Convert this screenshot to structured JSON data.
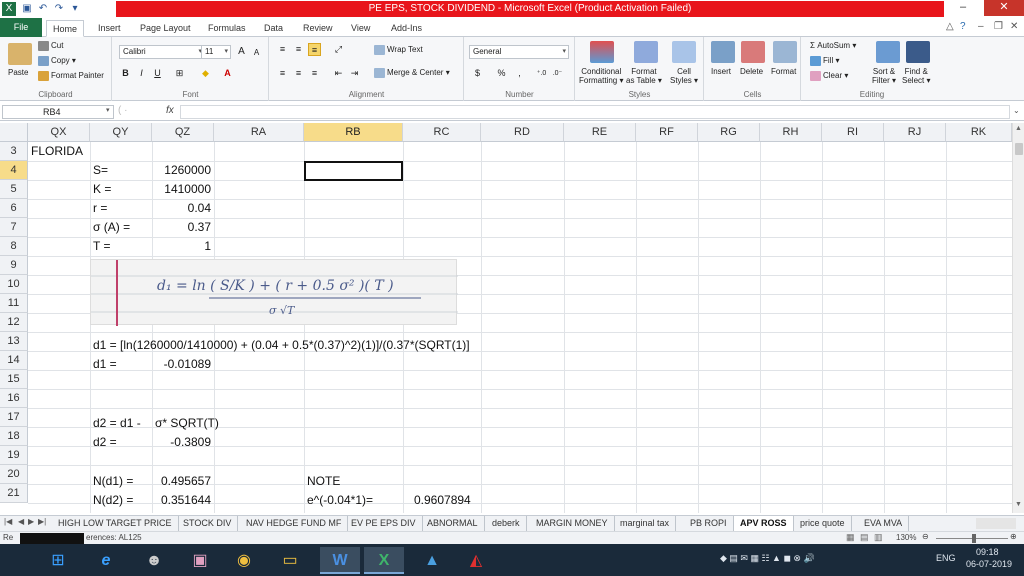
{
  "window": {
    "title": "PE EPS, STOCK DIVIDEND - Microsoft Excel (Product Activation Failed)",
    "accent": "#e8151b"
  },
  "ribbon_tabs": [
    "File",
    "Home",
    "Insert",
    "Page Layout",
    "Formulas",
    "Data",
    "Review",
    "View",
    "Add-Ins"
  ],
  "ribbon": {
    "clipboard": {
      "paste": "Paste",
      "cut": "Cut",
      "copy": "Copy",
      "format_painter": "Format Painter",
      "label": "Clipboard"
    },
    "font": {
      "name": "Calibri",
      "size": "11",
      "bold": "B",
      "italic": "I",
      "underline": "U",
      "label": "Font",
      "grow": "A",
      "shrink": "A"
    },
    "alignment": {
      "wrap": "Wrap Text",
      "merge": "Merge & Center",
      "label": "Alignment"
    },
    "number": {
      "format": "General",
      "currency": "$",
      "percent": "%",
      "comma": ",",
      "label": "Number"
    },
    "styles": {
      "conditional": "Conditional",
      "conditional2": "Formatting",
      "format_table": "Format",
      "format_table2": "as Table",
      "cell_styles": "Cell",
      "cell_styles2": "Styles",
      "label": "Styles"
    },
    "cells": {
      "insert": "Insert",
      "delete": "Delete",
      "format": "Format",
      "label": "Cells"
    },
    "editing": {
      "autosum": "AutoSum",
      "fill": "Fill",
      "clear": "Clear",
      "sort": "Sort &",
      "sort2": "Filter",
      "find": "Find &",
      "find2": "Select",
      "label": "Editing"
    }
  },
  "formula_bar": {
    "name_box": "RB4",
    "fx": "fx",
    "formula": ""
  },
  "columns": [
    "QX",
    "QY",
    "QZ",
    "RA",
    "RB",
    "RC",
    "RD",
    "RE",
    "RF",
    "RG",
    "RH",
    "RI",
    "RJ",
    "RK"
  ],
  "rows": [
    "3",
    "4",
    "5",
    "6",
    "7",
    "8",
    "9",
    "10",
    "11",
    "12",
    "13",
    "14",
    "15",
    "16",
    "17",
    "18",
    "19",
    "20",
    "21"
  ],
  "cells": {
    "qx3": "FLORIDA",
    "qy4": "S=",
    "qz4": "1260000",
    "qy5": "K =",
    "qz5": "1410000",
    "qy6": "r =",
    "qz6": "0.04",
    "qy7": "σ (A) =",
    "qz7": "0.37",
    "qy8": "T =",
    "qz8": "1",
    "qy13": "d1 = [ln(1260000/1410000) + (0.04 + 0.5*(0.37)^2)(1)]/(0.37*(SQRT(1)]",
    "qy14": "d1 =",
    "qz14": "-0.01089",
    "qy17": "d2 = d1 -",
    "qz17": "σ* SQRT(T)",
    "qy18": "d2 =",
    "qz18": "-0.3809",
    "qy20": "N(d1) =",
    "qz20": "0.495657",
    "rb20": "NOTE",
    "qy21": "N(d2) =",
    "qz21": "0.351644",
    "rb21": "e^(-0.04*1)=",
    "rc21": "0.9607894"
  },
  "handwriting_formula": "d₁ = ln ( S/K ) + ( r + 0.5 σ² )( T )",
  "handwriting_denominator": "σ √T",
  "sheet_tabs": [
    "HIGH LOW TARGET PRICE",
    "STOCK DIV",
    "NAV HEDGE FUND MF",
    "EV PE EPS DIV",
    "ABNORMAL",
    "deberk",
    "MARGIN MONEY",
    "marginal tax",
    "PB ROPI",
    "APV ROSS",
    "price quote",
    "EVA MVA"
  ],
  "active_sheet": "APV ROSS",
  "status": {
    "text": "erences: AL125",
    "zoom": "130%"
  },
  "taskbar": {
    "lang": "ENG",
    "time": "09:18",
    "date": "06-07-2019"
  }
}
